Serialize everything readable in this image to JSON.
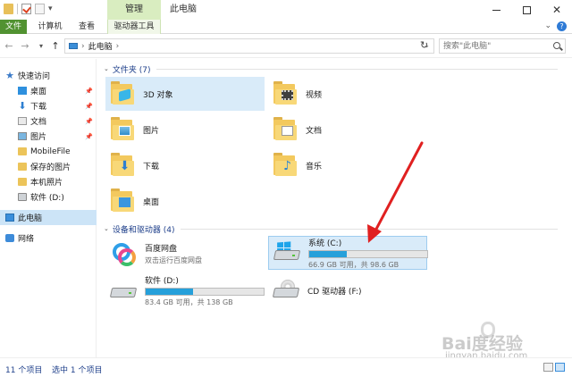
{
  "window": {
    "title": "此电脑",
    "context_tab": "管理"
  },
  "ribbon": {
    "tabs": [
      {
        "label": "文件"
      },
      {
        "label": "计算机"
      },
      {
        "label": "查看"
      },
      {
        "label": "驱动器工具"
      }
    ]
  },
  "address": {
    "crumb": "此电脑",
    "search_placeholder": "搜索\"此电脑\""
  },
  "nav": {
    "items": [
      {
        "label": "快速访问",
        "icon": "star-icon"
      },
      {
        "label": "桌面",
        "icon": "desktop-icon",
        "pinned": true
      },
      {
        "label": "下载",
        "icon": "download-icon",
        "pinned": true
      },
      {
        "label": "文档",
        "icon": "document-icon",
        "pinned": true
      },
      {
        "label": "图片",
        "icon": "picture-icon",
        "pinned": true
      },
      {
        "label": "MobileFile",
        "icon": "folder-icon"
      },
      {
        "label": "保存的图片",
        "icon": "folder-icon"
      },
      {
        "label": "本机照片",
        "icon": "folder-icon"
      },
      {
        "label": "软件 (D:)",
        "icon": "drive-icon"
      },
      {
        "label": "此电脑",
        "icon": "computer-icon",
        "selected": true
      },
      {
        "label": "网络",
        "icon": "network-icon"
      }
    ]
  },
  "folders": {
    "header": "文件夹 (7)",
    "items": [
      {
        "label": "3D 对象",
        "icon": "3d-objects-icon"
      },
      {
        "label": "视频",
        "icon": "video-icon"
      },
      {
        "label": "图片",
        "icon": "pictures-icon"
      },
      {
        "label": "文档",
        "icon": "documents-icon"
      },
      {
        "label": "下载",
        "icon": "downloads-icon"
      },
      {
        "label": "音乐",
        "icon": "music-icon"
      },
      {
        "label": "桌面",
        "icon": "desktop-folder-icon"
      }
    ]
  },
  "devices": {
    "header": "设备和驱动器 (4)",
    "items": [
      {
        "label": "百度网盘",
        "sub": "双击运行百度网盘",
        "icon": "baidu-netdisk-icon"
      },
      {
        "label": "系统 (C:)",
        "sub": "66.9 GB 可用，共 98.6 GB",
        "used_fraction": 0.32,
        "icon": "windows-drive-icon"
      },
      {
        "label": "软件 (D:)",
        "sub": "83.4 GB 可用，共 138 GB",
        "used_fraction": 0.4,
        "icon": "hard-drive-icon"
      },
      {
        "label": "CD 驱动器 (F:)",
        "icon": "cd-drive-icon"
      }
    ]
  },
  "status": {
    "count": "11 个项目",
    "selected": "选中 1 个项目"
  },
  "watermark": {
    "text": "Bai度经验",
    "url": "jingyan.baidu.com"
  },
  "colors": {
    "file_tab": "#519231",
    "manage_tab": "#d9edc0",
    "selection": "#cce4f7",
    "drive_bar": "#26a0da",
    "arrow": "#e02020"
  }
}
